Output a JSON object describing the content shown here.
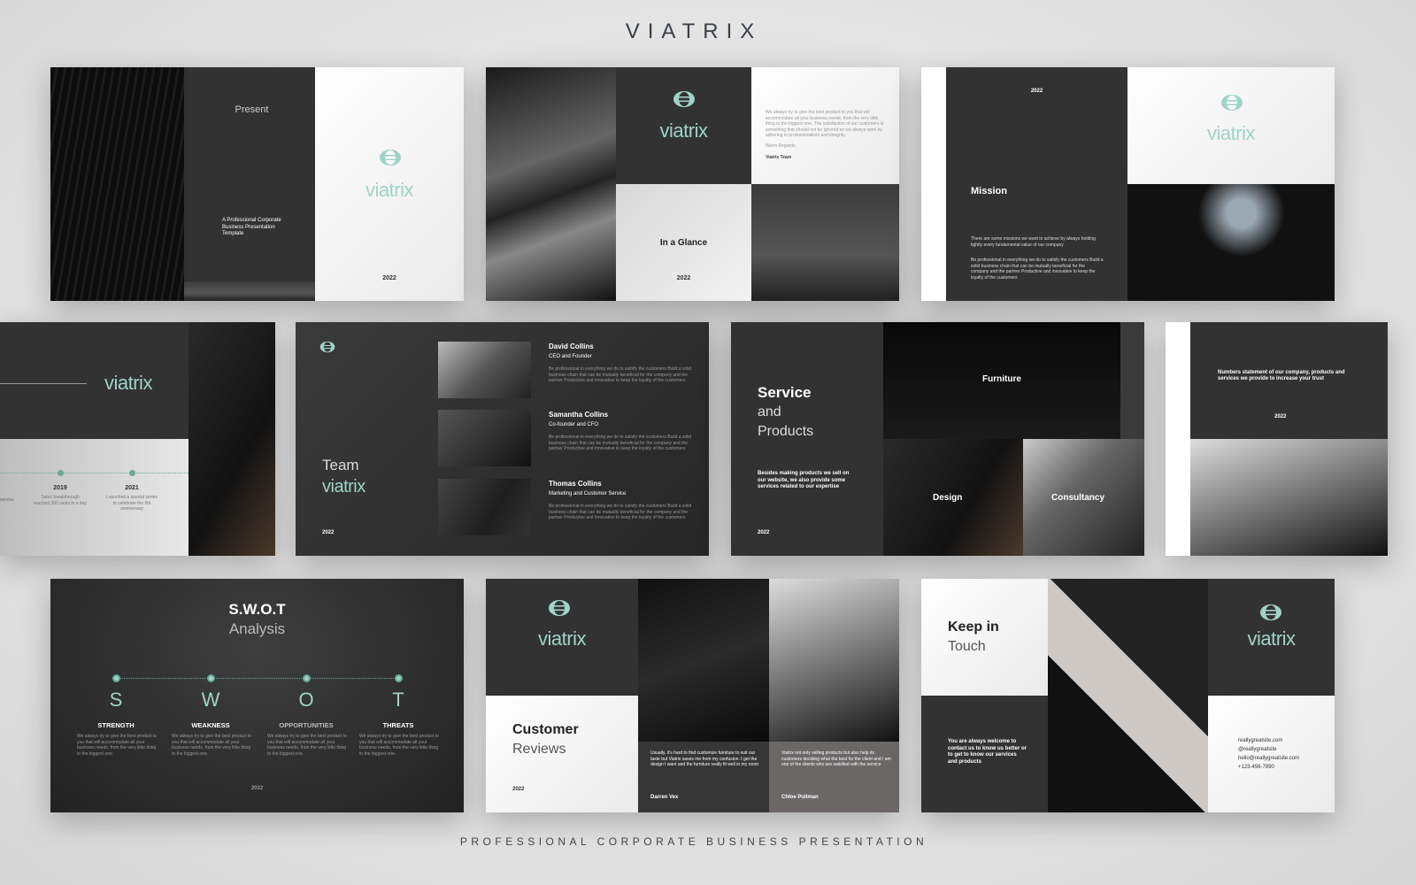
{
  "header": {
    "title": "VIATRIX"
  },
  "footer": {
    "tagline": "PROFESSIONAL CORPORATE BUSINESS PRESENTATION"
  },
  "brand": {
    "wordmark": "viatrix",
    "accent": "#9fd3c7",
    "logo_icon": "globe-logo-icon"
  },
  "slides": {
    "cover": {
      "present": "Present",
      "subtitle": "A Professional Corporate Business Presentation Template",
      "year": "2022"
    },
    "glance": {
      "letter": "We always try to give the best product to you that will accommodate all your business needs, from the very little thing to the biggest one. The satisfaction of our customers is something that should not be ignored so we always work by adhering to professionalism and integrity.",
      "regards": "Warm Regards,",
      "signature": "Viatrix Team",
      "title": "In a Glance",
      "year": "2022"
    },
    "mission": {
      "year": "2022",
      "title": "Mission",
      "p1": "There are some missions we want to achieve by always holding tightly every fundamental value of our company",
      "p2": "Be professional in everything we do to satisfy the customers Build a solid business chain that can be mutually beneficial for the company and the partner Productive and innovative to keep the loyalty of the customers"
    },
    "timeline": {
      "left_text": "service",
      "events": [
        {
          "year": "2019",
          "text": "Sales breakthrough reached 300 sales in a day"
        },
        {
          "year": "2021",
          "text": "Launched a special series to celebrate the 5th anniversary"
        }
      ]
    },
    "team": {
      "title": "Team",
      "year": "2022",
      "members": [
        {
          "name": "David Collins",
          "role": "CEO and Founder",
          "bio": "Be professional in everything we do to satisfy the customers Build a solid business chain that can be mutually beneficial for the company and the partner Productive and innovative to keep the loyalty of the customers"
        },
        {
          "name": "Samantha Collins",
          "role": "Co-founder and CFO",
          "bio": "Be professional in everything we do to satisfy the customers Build a solid business chain that can be mutually beneficial for the company and the partner Productive and innovative to keep the loyalty of the customers"
        },
        {
          "name": "Thomas Collins",
          "role": "Marketing and Customer Service",
          "bio": "Be professional in everything we do to satisfy the customers Build a solid business chain that can be mutually beneficial for the company and the partner Productive and innovative to keep the loyalty of the customers"
        }
      ]
    },
    "services": {
      "title1": "Service",
      "title2": "and",
      "title3": "Products",
      "desc": "Besides making products we sell on our website, we also provide some services related to our expertise",
      "year": "2022",
      "categories": [
        "Furniture",
        "Design",
        "Consultancy"
      ]
    },
    "numbers": {
      "text": "Numbers statement of our company, products and services we provide to increase your trust",
      "year": "2022"
    },
    "swot": {
      "title": "S.W.O.T",
      "subtitle": "Analysis",
      "year": "2022",
      "items": [
        {
          "letter": "S",
          "label": "STRENGTH",
          "text": "We always try to give the best product to you that will accommodate all your business needs, from the very little thing to the biggest one."
        },
        {
          "letter": "W",
          "label": "WEAKNESS",
          "text": "We always try to give the best product to you that will accommodate all your business needs, from the very little thing to the biggest one."
        },
        {
          "letter": "O",
          "label": "OPPORTUNITIES",
          "text": "We always try to give the best product to you that will accommodate all your business needs, from the very little thing to the biggest one."
        },
        {
          "letter": "T",
          "label": "THREATS",
          "text": "We always try to give the best product to you that will accommodate all your business needs, from the very little thing to the biggest one."
        }
      ]
    },
    "reviews": {
      "title1": "Customer",
      "title2": "Reviews",
      "year": "2022",
      "items": [
        {
          "text": "Usually, it's hard to find customize furniture to suit our taste but Viatrix saves me from my confusion. I get the design I want and the furniture really fit well in my room",
          "name": "Darren Vex"
        },
        {
          "text": "Viatrix not only selling products but also help its customers deciding what the best for the client and I am one of the clients who are satisfied with the service",
          "name": "Chloe Pullman"
        }
      ]
    },
    "contact": {
      "title1": "Keep in",
      "title2": "Touch",
      "text": "You are always welcome to contact us to know us better or to get to know our services and products",
      "website": "reallygreatsite.com",
      "handle": "@reallygreatsite",
      "email": "hello@reallygreatsite.com",
      "phone": "+123-456-7890"
    }
  }
}
